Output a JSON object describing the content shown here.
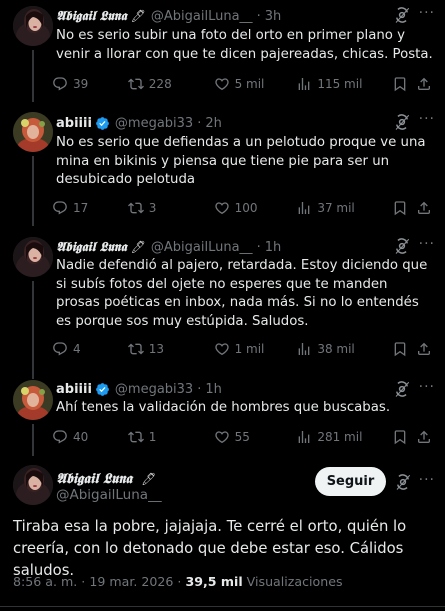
{
  "tweets": [
    {
      "name": "𝕬𝖇𝖎𝖌𝖆𝖎𝖑 𝕷𝖚𝖓𝖆",
      "pen": "🖊",
      "handle": "@AbigailLuna__",
      "sep": "·",
      "time": "3h",
      "text": "No es serio subir una foto del orto en primer plano y venir a llorar con que te dicen pajereadas, chicas. Posta.",
      "replies": "39",
      "retweets": "228",
      "likes": "5 mil",
      "views": "115 mil"
    },
    {
      "name": "abiiii",
      "verified": true,
      "handle": "@megabi33",
      "sep": "·",
      "time": "2h",
      "text": "No es serio que defiendas a un pelotudo proque ve una mina en bikinis y piensa que tiene pie para ser un desubicado pelotuda",
      "replies": "17",
      "retweets": "3",
      "likes": "100",
      "views": "37 mil"
    },
    {
      "name": "𝕬𝖇𝖎𝖌𝖆𝖎𝖑 𝕷𝖚𝖓𝖆",
      "pen": "🖊",
      "handle": "@AbigailLuna__",
      "sep": "·",
      "time": "1h",
      "text": "Nadie defendió al pajero, retardada. Estoy diciendo que si subís fotos del ojete no esperes que te manden prosas poéticas en inbox, nada más. Si no lo entendés es porque sos muy estúpida. Saludos.",
      "replies": "4",
      "retweets": "13",
      "likes": "1 mil",
      "views": "38 mil"
    },
    {
      "name": "abiiii",
      "verified": true,
      "handle": "@megabi33",
      "sep": "·",
      "time": "1h",
      "text": "Ahí tenes la validación de hombres que buscabas.",
      "replies": "40",
      "retweets": "1",
      "likes": "55",
      "views": "281 mil"
    }
  ],
  "main": {
    "name": "𝕬𝖇𝖎𝖌𝖆𝖎𝖑 𝕷𝖚𝖓𝖆",
    "pen": "🖊",
    "handle": "@AbigailLuna__",
    "follow_label": "Seguir",
    "text": "Tiraba esa la pobre, jajajaja. Te cerré el orto, quién lo creería, con lo detonado que debe estar eso. Cálidos saludos.",
    "time": "8:56 a. m.",
    "date": "19 mar. 2026",
    "views_count": "39,5 mil",
    "views_label": "Visualizaciones"
  },
  "colors": {
    "background": "#000000",
    "text": "#e7e9ea",
    "muted": "#71767b",
    "verified": "#1d9bf0"
  },
  "icons": [
    "reply-icon",
    "retweet-icon",
    "like-icon",
    "views-icon",
    "bookmark-icon",
    "share-icon",
    "grok-icon",
    "more-icon",
    "verified-icon"
  ]
}
